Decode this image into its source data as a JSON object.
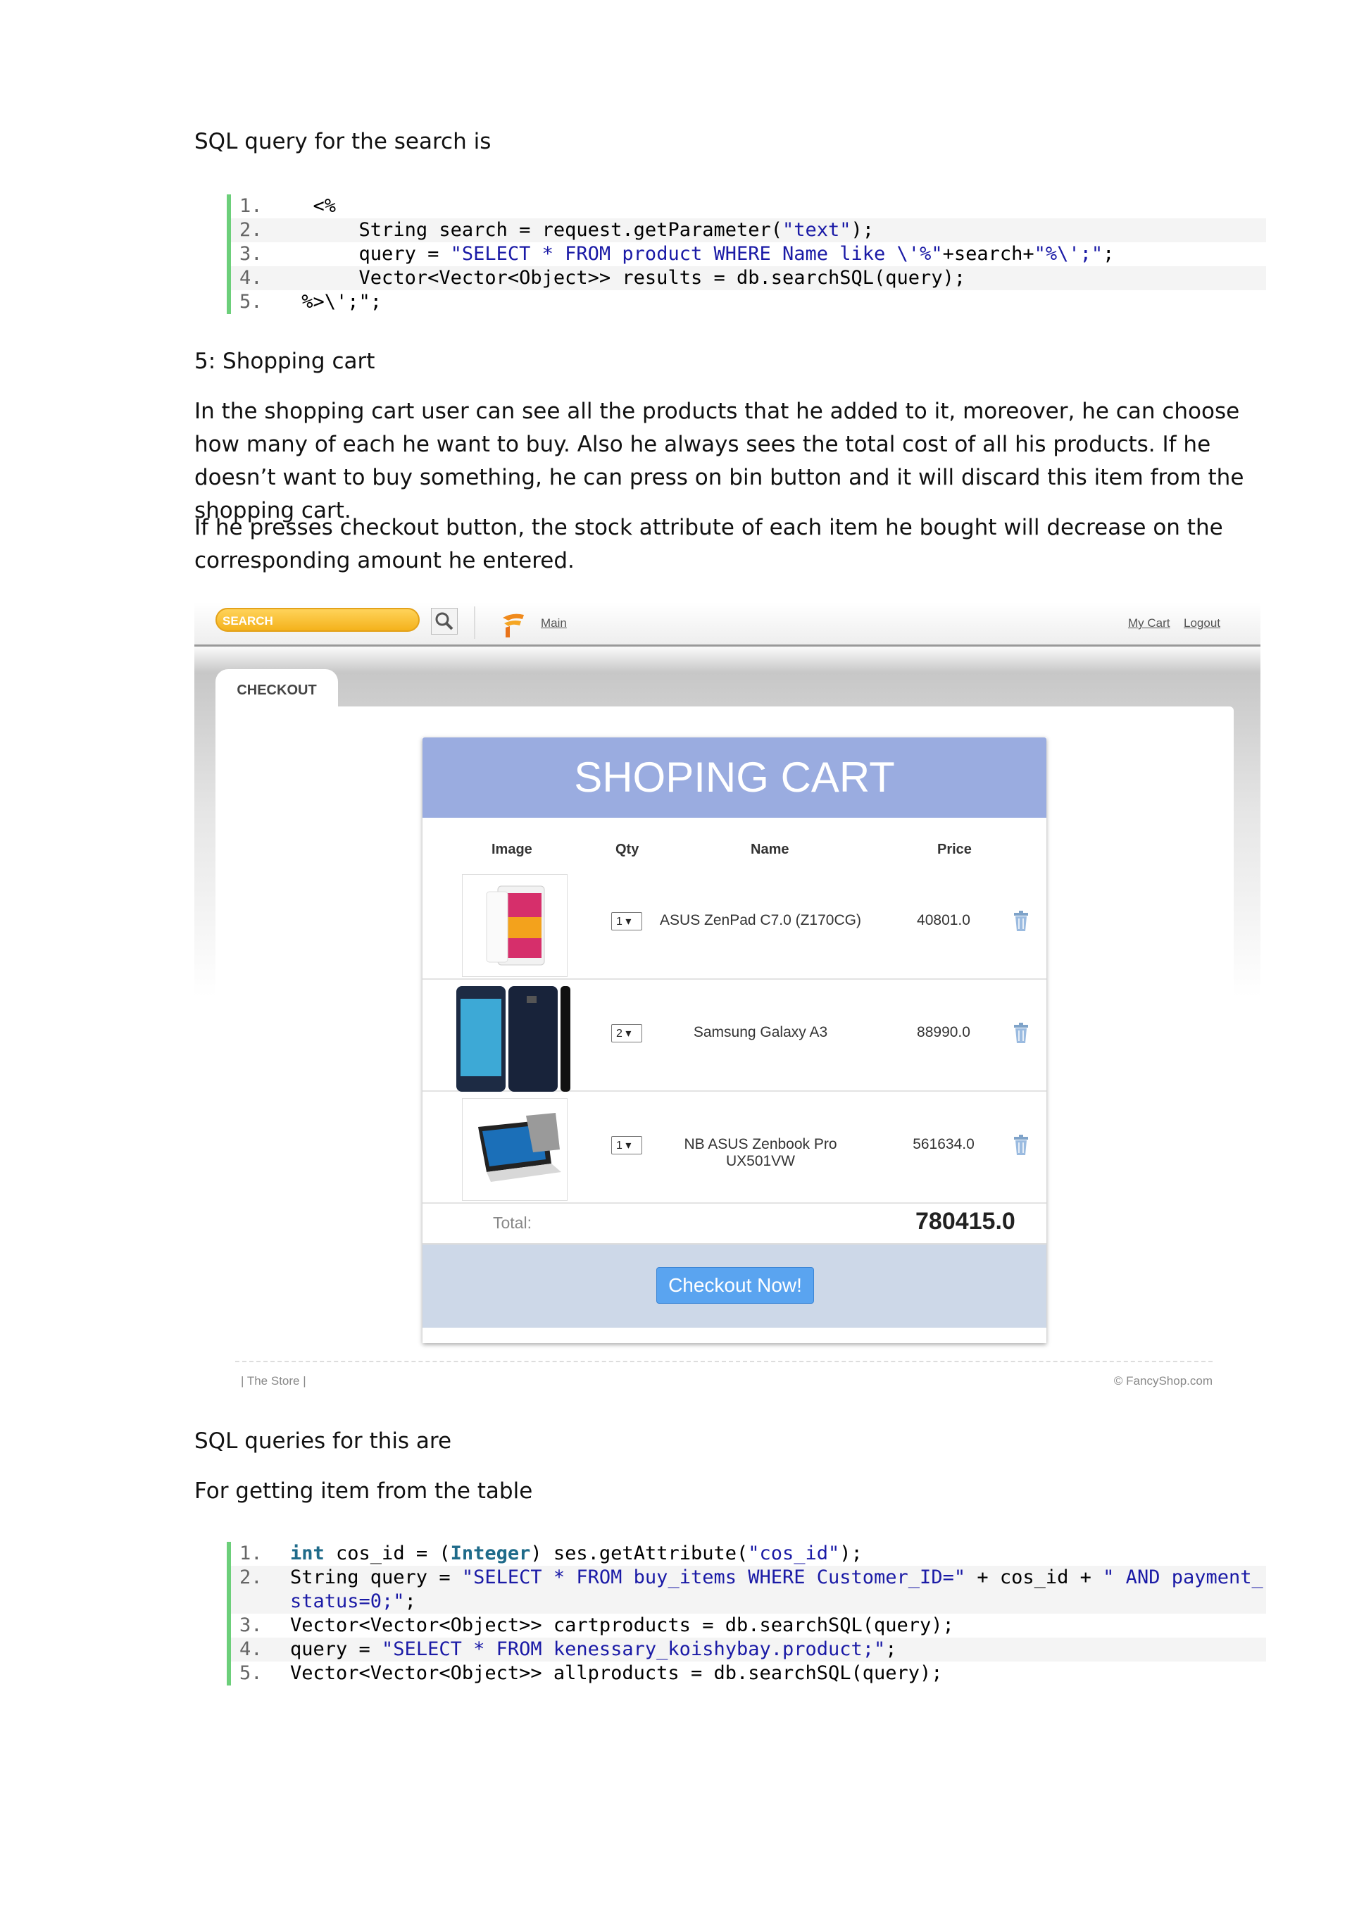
{
  "doc": {
    "para1": "SQL query for the search is",
    "heading5": "5: Shopping cart",
    "para2": "In the shopping cart user can see all the products that he added to it, moreover, he can choose how many of each he want to buy. Also he always sees the total cost of all his products. If he doesn’t want to buy something, he can press on bin button and it will discard this item from the shopping cart.",
    "para3": "If he presses checkout button, the stock attribute of each item he bought will decrease on the corresponding amount he entered.",
    "para4": "SQL queries for this are",
    "para5": "For getting item from the table"
  },
  "code1": {
    "numbers": [
      "1.",
      "2.",
      "3.",
      "4.",
      "5."
    ],
    "l1": "  <%",
    "l2": "      String search = request.getParameter(",
    "l2s": "\"text\"",
    "l2e": ");",
    "l3a": "      query = ",
    "l3s1": "\"SELECT * FROM product WHERE Name like \\'%\"",
    "l3b": "+search+",
    "l3s2": "\"%\\';\"",
    "l3e": ";",
    "l4": "      Vector<Vector<Object>> results = db.searchSQL(query);",
    "l5": " %>\\';\";"
  },
  "code2": {
    "numbers": [
      "1.",
      "2.",
      "3.",
      "4.",
      "5."
    ],
    "l1kw": "int",
    "l1a": " cos_id = (",
    "l1kw2": "Integer",
    "l1b": ") ses.getAttribute(",
    "l1s": "\"cos_id\"",
    "l1e": ");",
    "l2a": "String query = ",
    "l2s1": "\"SELECT * FROM buy_items WHERE Customer_ID=\"",
    "l2b": " + cos_id + ",
    "l2s2": "\" AND payment_status=0;\"",
    "l2e": ";",
    "l3": "Vector<Vector<Object>> cartproducts = db.searchSQL(query);",
    "l4a": "query = ",
    "l4s": "\"SELECT * FROM kenessary_koishybay.product;\"",
    "l4e": ";",
    "l5": "Vector<Vector<Object>> allproducts = db.searchSQL(query);"
  },
  "shop": {
    "search_placeholder": "SEARCH",
    "nav_main": "Main",
    "nav_cart": "My Cart",
    "nav_logout": "Logout",
    "tab_checkout": "CHECKOUT",
    "cart_title": "SHOPING CART",
    "col_image": "Image",
    "col_qty": "Qty",
    "col_name": "Name",
    "col_price": "Price",
    "items": [
      {
        "qty": "1 ▾",
        "name": "ASUS ZenPad C7.0 (Z170CG)",
        "price": "40801.0"
      },
      {
        "qty": "2 ▾",
        "name": "Samsung Galaxy A3",
        "price": "88990.0"
      },
      {
        "qty": "1 ▾",
        "name": "NB ASUS Zenbook Pro UX501VW",
        "price": "561634.0"
      }
    ],
    "total_label": "Total:",
    "total_value": "780415.0",
    "checkout_button": "Checkout Now!",
    "footer_left": "|  The Store  |",
    "footer_right": "© FancyShop.com",
    "accent_color": "#9aace0"
  }
}
